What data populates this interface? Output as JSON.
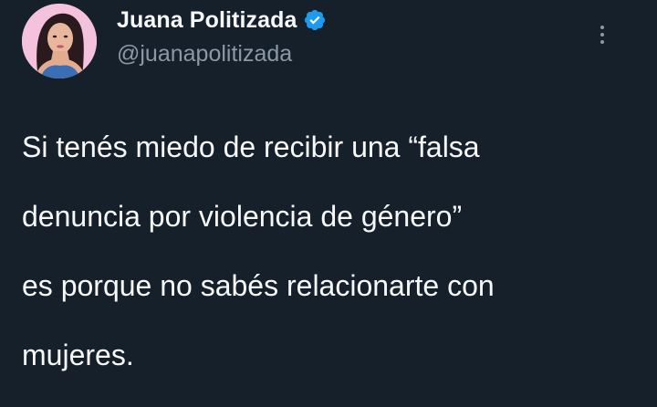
{
  "author": {
    "display_name": "Juana Politizada",
    "handle": "@juanapolitizada",
    "verified_icon": "verified-badge-icon",
    "avatar_icon": "profile-avatar"
  },
  "menu": {
    "icon": "more-options-icon"
  },
  "tweet": {
    "lines": [
      "Si tenés miedo de recibir una “falsa",
      "denuncia por violencia de género”",
      "es porque no sabés relacionarte con",
      "mujeres."
    ]
  },
  "colors": {
    "background": "#15202b",
    "text": "#f7f9f9",
    "secondary": "#8b98a5",
    "verified": "#1d9bf0"
  }
}
